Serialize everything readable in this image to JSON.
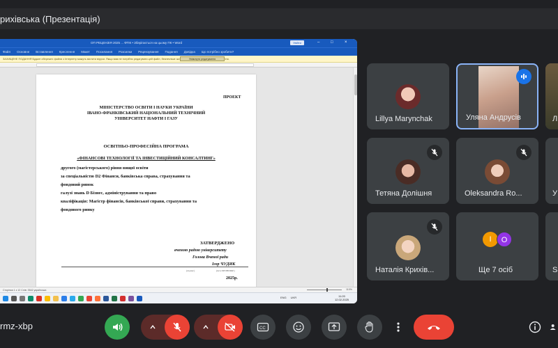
{
  "presenter": {
    "title": "рихівська (Презентація)"
  },
  "word": {
    "doc_title": "ОП РЕЦЕНЗІЯ 2025 ... ФТІК • Зберігається на цьому ПК • Word",
    "badge": "Увійти",
    "menu": [
      "Файл",
      "Основне",
      "Вставлення",
      "Креслення",
      "Макет",
      "Посилання",
      "Розсилки",
      "Рецензування",
      "Подання",
      "Довідка",
      "Що потрібно зробити?"
    ],
    "infobar_text": "ЗАХИЩЕНЕ ПОДАННЯ   Будьте обережні: файли з Інтернету можуть містити віруси. Якщо вам не потрібно редагувати цей файл, безпечніше залишатися в режимі захищеного подання.",
    "infobar_button": "Увімкнути редагування",
    "status_left": "Сторінка 1 з 12   Слів: 3542   українська",
    "zoom": "110%",
    "tray": [
      "ENG",
      "UKR"
    ],
    "clock_time": "11:20",
    "clock_date": "12.02.2025"
  },
  "document": {
    "proekt": "ПРОЕКТ",
    "ministry": [
      "МІНІСТЕРСТВО ОСВІТИ І НАУКИ УКРАЇНИ",
      "ІВАНО-ФРАНКІВСЬКИЙ НАЦІОНАЛЬНИЙ ТЕХНІЧНИЙ",
      "УНІВЕРСИТЕТ НАФТИ І ГАЗУ"
    ],
    "program": "ОСВІТНЬО-ПРОФЕСІЙНА ПРОГРАМА",
    "program_name": "«ФІНАНСОВІ ТЕХНОЛОГІЇ ТА ІНВЕСТИЦІЙНИЙ КОНСАЛТИНГ»",
    "body": [
      "другого (магістерського) рівня вищої освіти",
      "за спеціальністю D2 Фінанси, банківська справа, страхування та",
      "фондовий ринок",
      "галузі знань D Бізнес, адміністрування та право",
      "кваліфікація: Магістр фінансів, банківської справи, страхування та",
      "фондового ринку"
    ],
    "approved": "ЗАТВЕРДЖЕНО",
    "approved_lines": [
      "вченою радою університету",
      "Голова Вченої ради",
      "Ігор ЧУДИК"
    ],
    "sig_small_1": "(підпис)",
    "sig_small_2": "(ім'я ПРІЗВИЩЕ)",
    "year": "2025р."
  },
  "participants": [
    {
      "name": "Lillya Marynchak",
      "muted": false
    },
    {
      "name": "Уляна Андрусів",
      "speaking": true
    },
    {
      "name": "Тетяна Долішня",
      "muted": true
    },
    {
      "name": "Oleksandra Ro...",
      "muted": true
    },
    {
      "name": "Наталія Крихів...",
      "muted": true
    },
    {
      "name": "Ще 7 осіб",
      "avatars": [
        "I",
        "O"
      ]
    }
  ],
  "edge_tiles": [
    "Л",
    "У",
    "S"
  ],
  "meeting": {
    "code": "rmz-xbp"
  },
  "colors": {
    "accent_blue": "#8ab4f8",
    "speak_blue": "#1a73e8",
    "green": "#34a853",
    "red": "#ea4335",
    "dark_red": "#5c2b29",
    "avatar_orange": "#f29900",
    "avatar_purple": "#9334e6"
  }
}
